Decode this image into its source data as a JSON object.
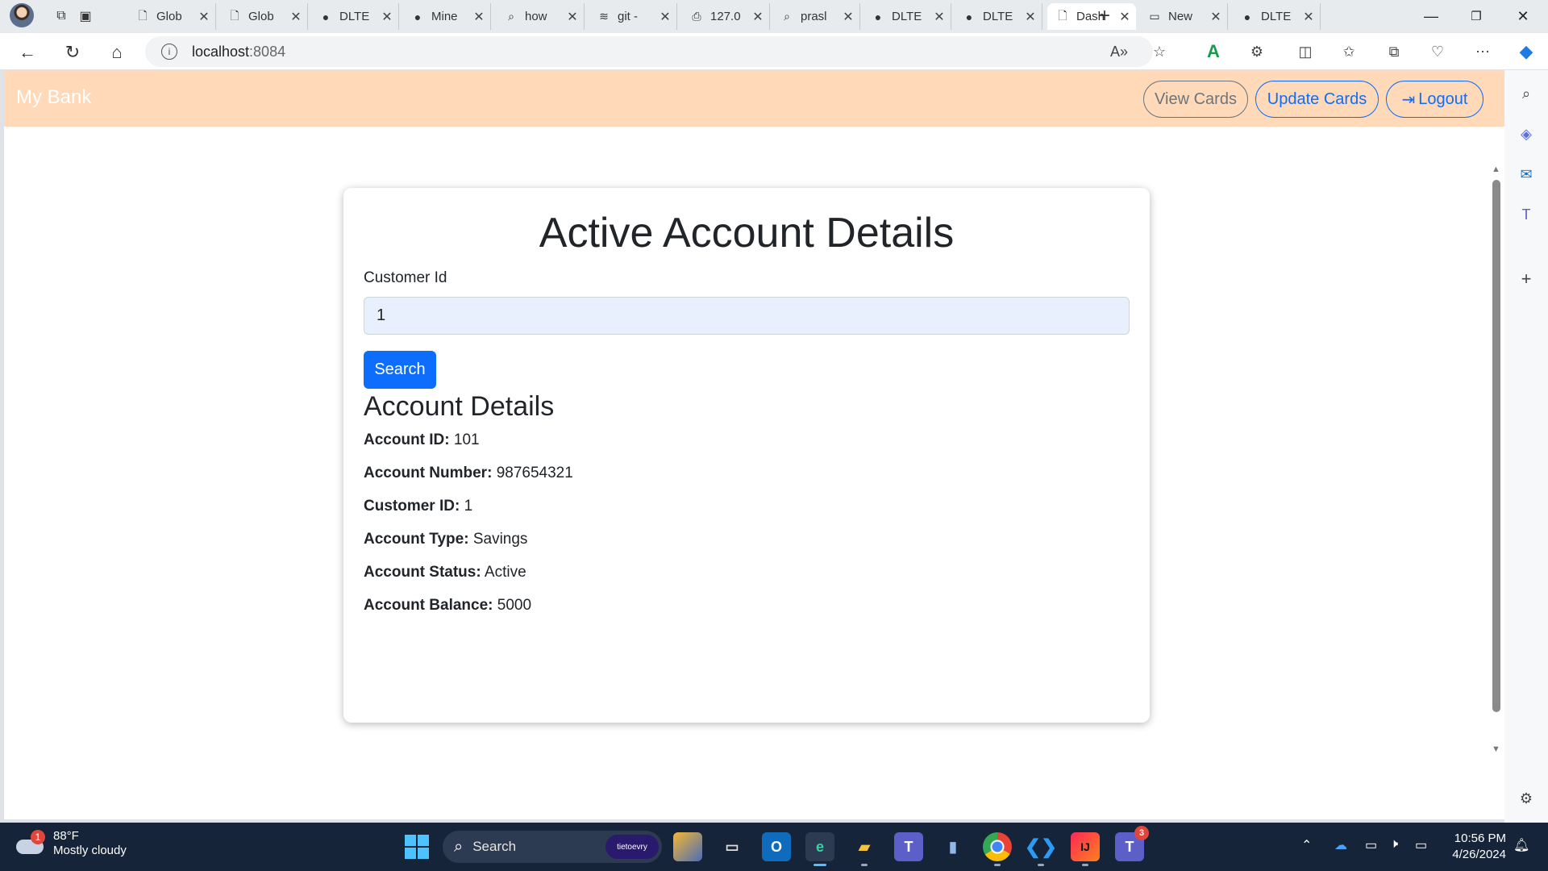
{
  "browser": {
    "tabs": [
      {
        "label": "Glob",
        "icon": "page-icon"
      },
      {
        "label": "Glob",
        "icon": "page-icon"
      },
      {
        "label": "DLTE",
        "icon": "github-icon"
      },
      {
        "label": "Mine",
        "icon": "github-icon"
      },
      {
        "label": "how",
        "icon": "search-icon"
      },
      {
        "label": "git -",
        "icon": "stack-icon"
      },
      {
        "label": "127.0",
        "icon": "lock-page-icon"
      },
      {
        "label": "prasl",
        "icon": "search-icon"
      },
      {
        "label": "DLTE",
        "icon": "github-icon"
      },
      {
        "label": "DLTE",
        "icon": "github-icon"
      },
      {
        "label": "Dash",
        "icon": "page-icon",
        "active": true
      },
      {
        "label": "New",
        "icon": "newtab-icon"
      },
      {
        "label": "DLTE",
        "icon": "github-icon"
      }
    ],
    "url": {
      "host": "localhost",
      "port": ":8084"
    }
  },
  "app": {
    "brand": "My Bank",
    "nav": {
      "view_cards": "View Cards",
      "update_cards": "Update Cards",
      "logout": "Logout"
    },
    "colors": {
      "navbar_bg": "#ffd9b8",
      "primary": "#0d6efd",
      "secondary": "#6c757d"
    }
  },
  "form": {
    "title": "Active Account Details",
    "customer_id_label": "Customer Id",
    "customer_id_value": "1",
    "search_label": "Search"
  },
  "account": {
    "heading": "Account Details",
    "rows": [
      {
        "label": "Account ID:",
        "value": "101"
      },
      {
        "label": "Account Number:",
        "value": "987654321"
      },
      {
        "label": "Customer ID:",
        "value": "1"
      },
      {
        "label": "Account Type:",
        "value": "Savings"
      },
      {
        "label": "Account Status:",
        "value": "Active"
      },
      {
        "label": "Account Balance:",
        "value": "5000"
      }
    ]
  },
  "taskbar": {
    "weather": {
      "temp": "88°F",
      "condition": "Mostly cloudy",
      "badge": "1"
    },
    "search_placeholder": "Search",
    "promo": "tietoevry",
    "teams_badge": "3",
    "time": "10:56 PM",
    "date": "4/26/2024"
  }
}
